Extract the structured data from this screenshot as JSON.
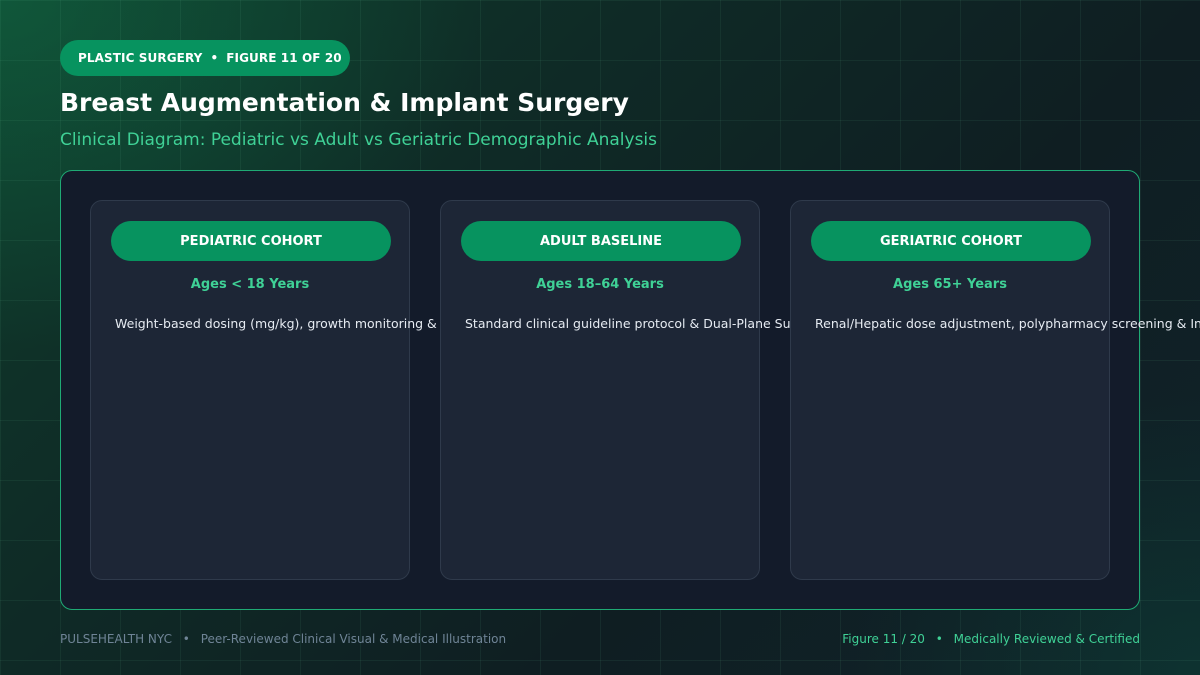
{
  "badge": {
    "category": "PLASTIC SURGERY",
    "separator": "•",
    "figure": "FIGURE 11 OF 20"
  },
  "title": "Breast Augmentation & Implant Surgery",
  "subtitle": "Clinical Diagram: Pediatric vs Adult vs Geriatric Demographic Analysis",
  "cards": [
    {
      "header": "PEDIATRIC COHORT",
      "range": "Ages < 18 Years",
      "body": "Weight-based dosing (mg/kg), growth monitoring & Col"
    },
    {
      "header": "ADULT BASELINE",
      "range": "Ages 18–64 Years",
      "body": "Standard clinical guideline protocol & Dual-Plane Submu"
    },
    {
      "header": "GERIATRIC COHORT",
      "range": "Ages 65+ Years",
      "body": "Renal/Hepatic dose adjustment, polypharmacy screening & Infram"
    }
  ],
  "footer": {
    "brand": "PULSEHEALTH NYC",
    "separator": "•",
    "tagline": "Peer-Reviewed Clinical Visual & Medical Illustration",
    "figure": "Figure 11 / 20",
    "certification": "Medically Reviewed & Certified"
  },
  "colors": {
    "accent": "#07935f",
    "accent_text": "#3fd196",
    "panel_border": "#1faa74",
    "panel_bg": "#131b2a",
    "card_bg": "#1d2636"
  }
}
